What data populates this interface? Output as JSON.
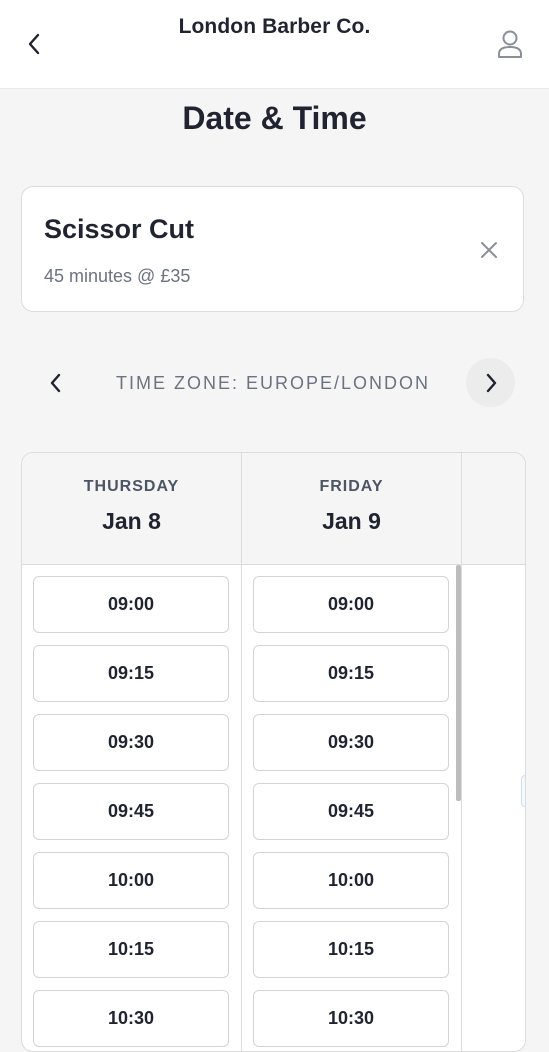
{
  "header": {
    "brand": "London Barber Co.",
    "back_icon": "chevron-left-icon",
    "profile_icon": "user-icon"
  },
  "page": {
    "title": "Date & Time"
  },
  "service": {
    "name": "Scissor Cut",
    "meta": "45 minutes @ £35",
    "remove_icon": "close-icon"
  },
  "timezone": {
    "label": "TIME ZONE: EUROPE/LONDON",
    "prev_icon": "chevron-left-icon",
    "next_icon": "chevron-right-icon"
  },
  "days": [
    {
      "name": "THURSDAY",
      "date": "Jan 8",
      "slots": [
        "09:00",
        "09:15",
        "09:30",
        "09:45",
        "10:00",
        "10:15",
        "10:30"
      ]
    },
    {
      "name": "FRIDAY",
      "date": "Jan 9",
      "slots": [
        "09:00",
        "09:15",
        "09:30",
        "09:45",
        "10:00",
        "10:15",
        "10:30"
      ]
    }
  ],
  "colors": {
    "background": "#f5f5f5",
    "text": "#1f2430",
    "muted": "#6b7280",
    "border": "#dcdcdc"
  }
}
